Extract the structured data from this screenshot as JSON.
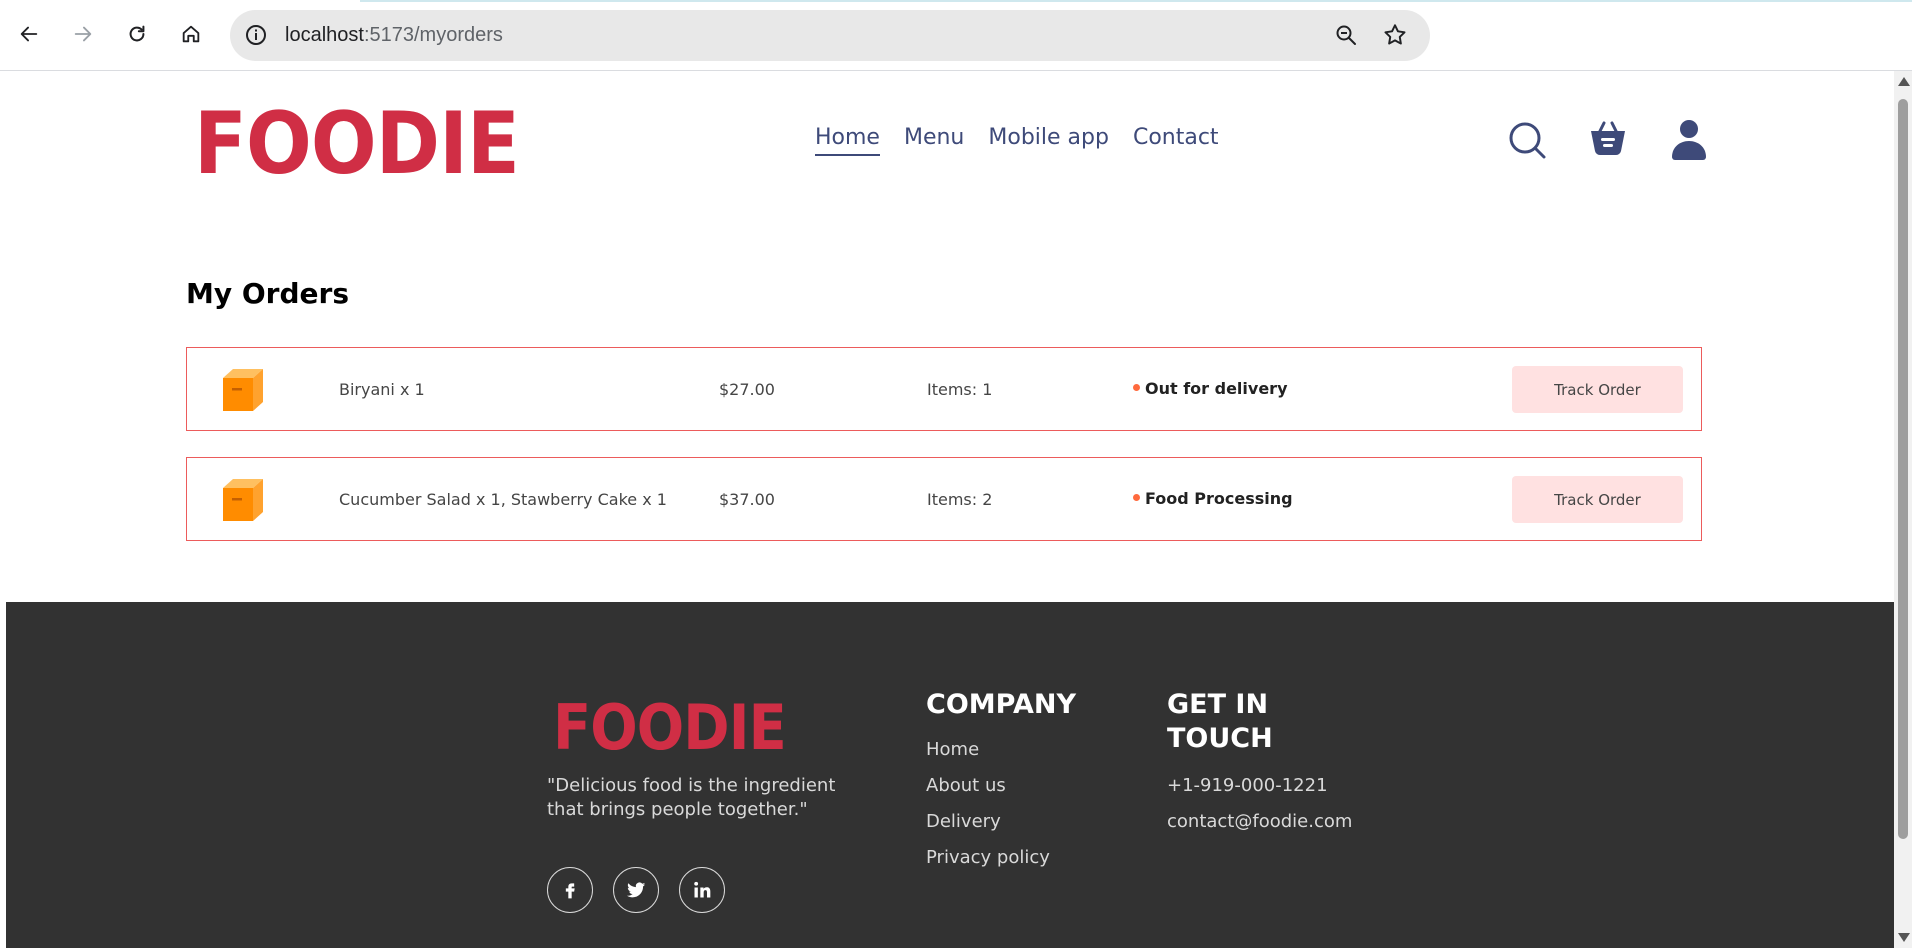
{
  "browser": {
    "url_host": "localhost",
    "url_path": ":5173/myorders"
  },
  "site": {
    "logo": "FOODIE",
    "nav": [
      "Home",
      "Menu",
      "Mobile app",
      "Contact"
    ],
    "active_nav": "Home"
  },
  "orders_page": {
    "title": "My Orders",
    "orders": [
      {
        "items": "Biryani x 1",
        "amount": "$27.00",
        "count": "Items: 1",
        "status": "Out for delivery",
        "button": "Track Order"
      },
      {
        "items": "Cucumber Salad x 1, Stawberry Cake x 1",
        "amount": "$37.00",
        "count": "Items: 2",
        "status": "Food Processing",
        "button": "Track Order"
      }
    ]
  },
  "footer": {
    "logo": "FOODIE",
    "tagline": "\"Delicious food is the ingredient that brings people together.\"",
    "company_heading": "COMPANY",
    "company_links": [
      "Home",
      "About us",
      "Delivery",
      "Privacy policy"
    ],
    "contact_heading_line1": "GET IN",
    "contact_heading_line2": "TOUCH",
    "phone": "+1-919-000-1221",
    "email": "contact@foodie.com",
    "social_icons": [
      "facebook-icon",
      "twitter-icon",
      "linkedin-icon"
    ]
  },
  "colors": {
    "brand_red": "#d02e45",
    "nav_blue": "#3e4a79",
    "order_border": "#ec5b5b",
    "track_button_bg": "#ffe1e1",
    "status_dot": "#ff6a3d",
    "footer_bg": "#323232"
  }
}
